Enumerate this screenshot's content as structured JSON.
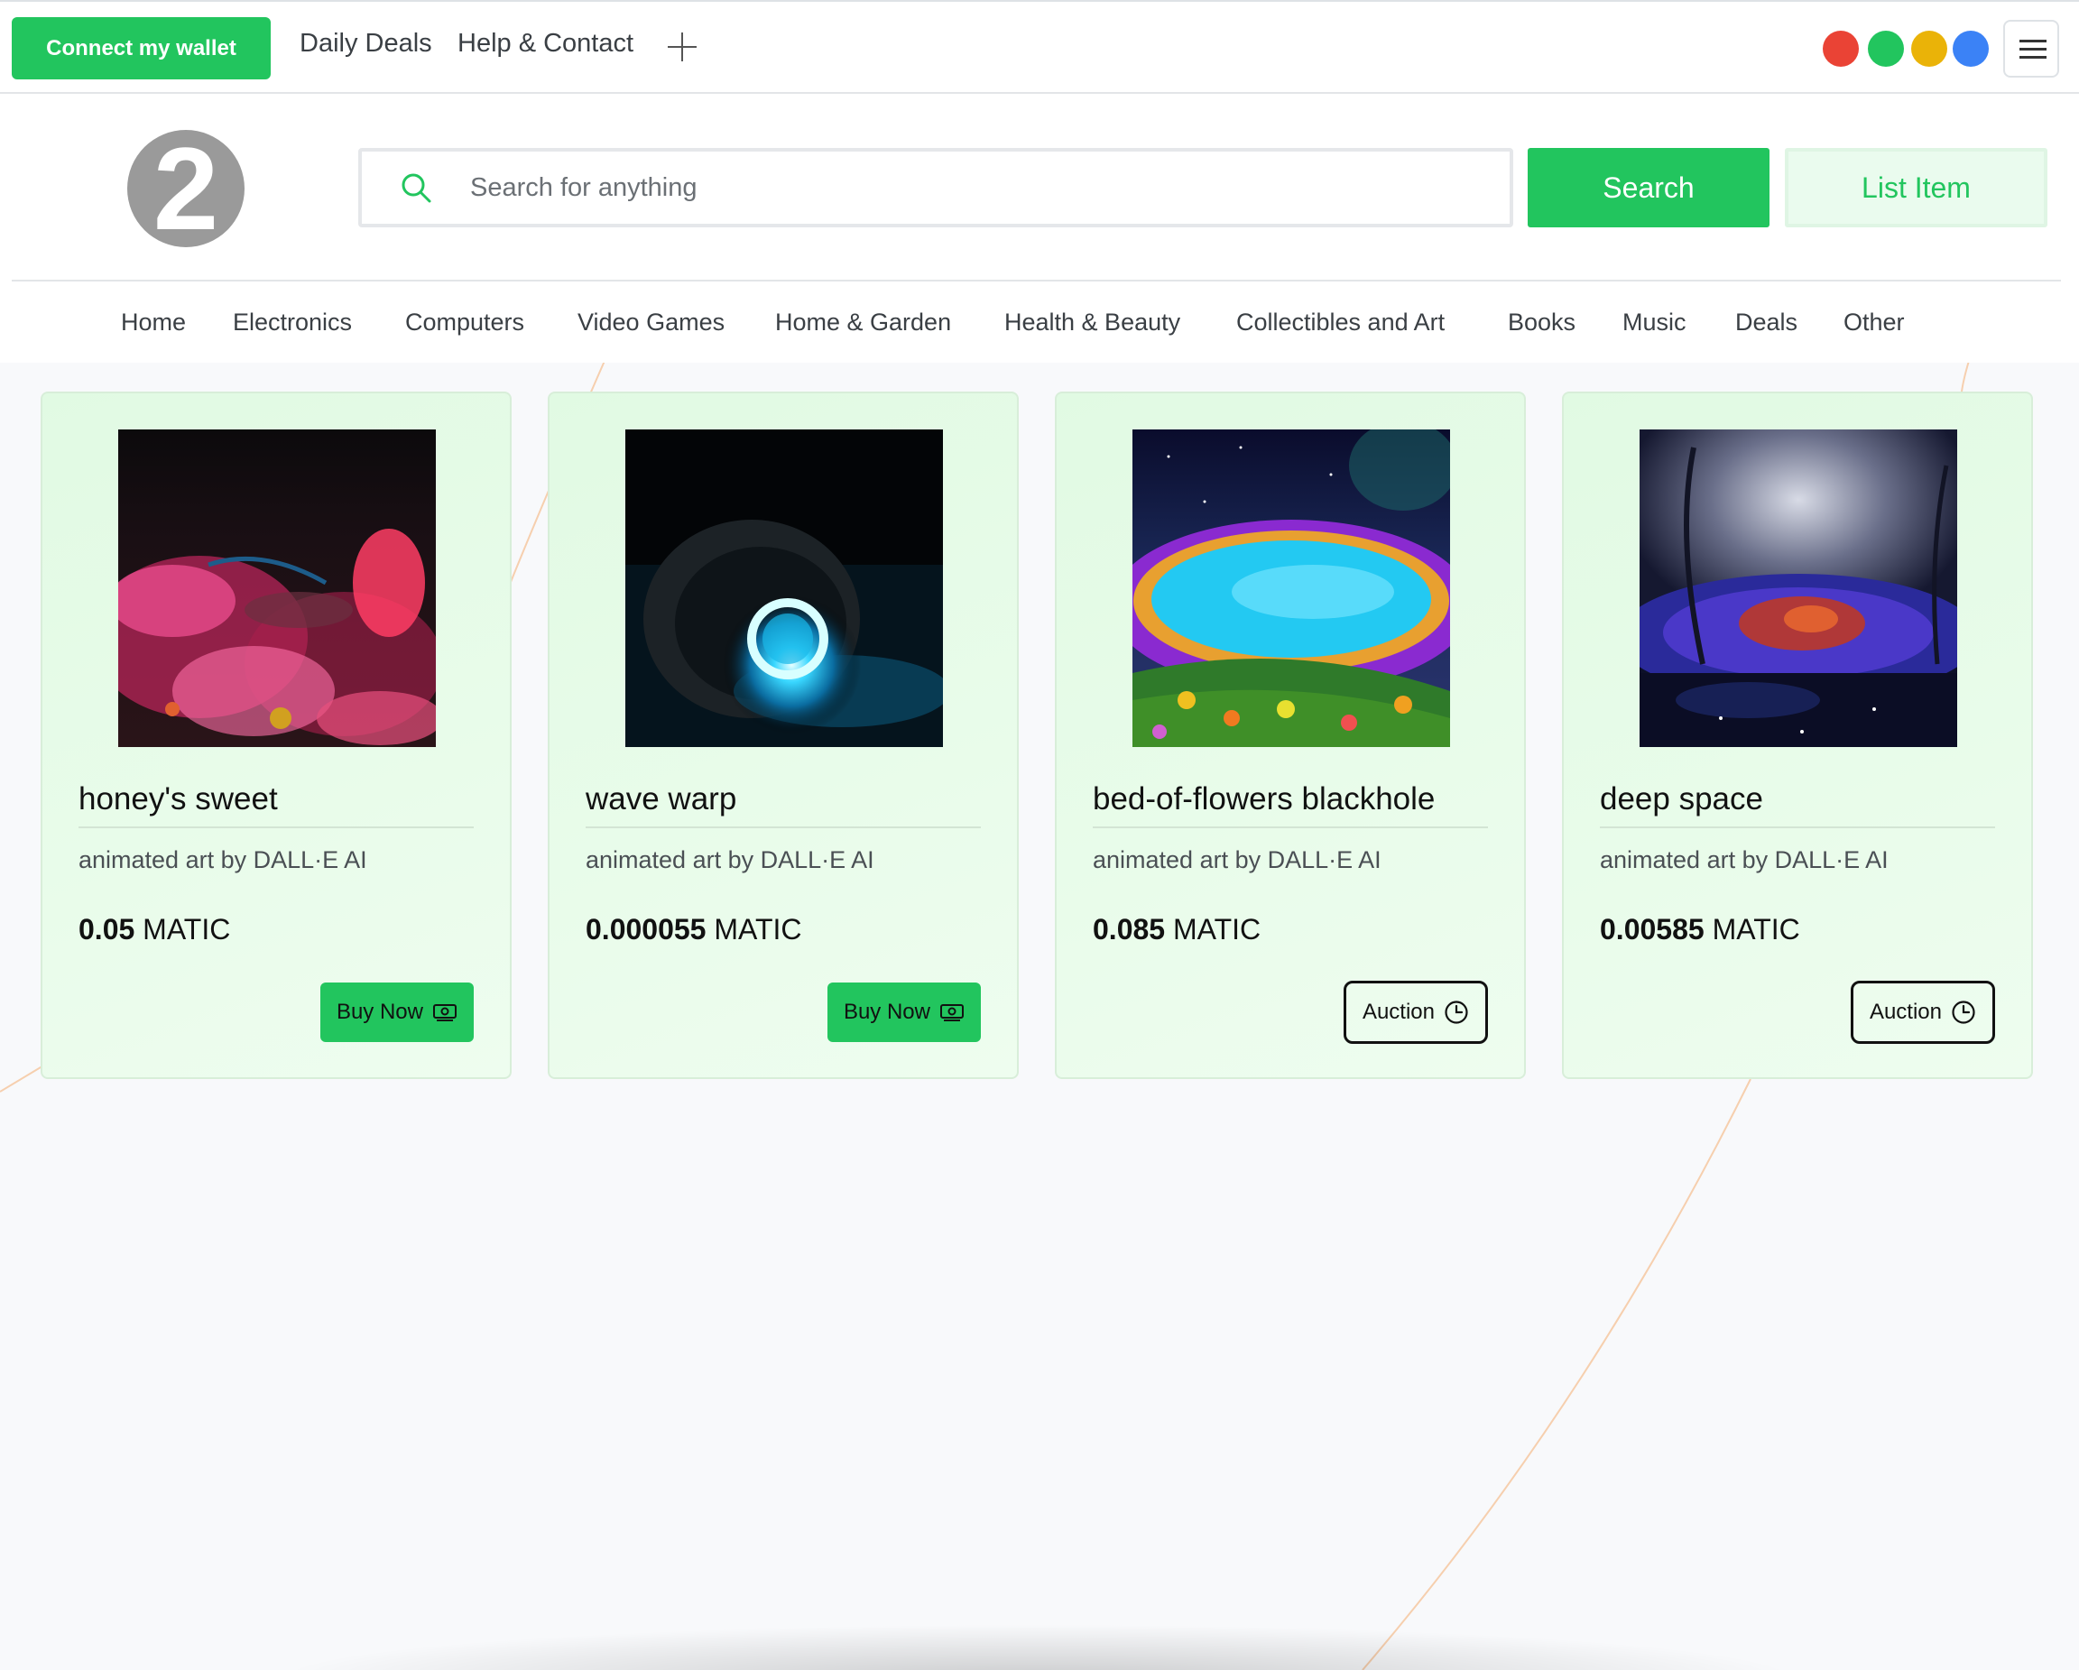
{
  "topbar": {
    "connect_label": "Connect my wallet",
    "links": [
      "Daily Deals",
      "Help & Contact"
    ],
    "dot_colors": [
      "#ea4335",
      "#22c55e",
      "#eab308",
      "#3b82f6"
    ]
  },
  "header": {
    "logo_text": "2",
    "search_placeholder": "Search for anything",
    "search_label": "Search",
    "list_label": "List Item"
  },
  "categories": [
    "Home",
    "Electronics",
    "Computers",
    "Video Games",
    "Home & Garden",
    "Health & Beauty",
    "Collectibles and Art",
    "Books",
    "Music",
    "Deals",
    "Other"
  ],
  "cards": [
    {
      "title": "honey's sweet",
      "desc": "animated art by DALL·E AI",
      "price": "0.05",
      "currency": "MATIC",
      "action": "Buy Now",
      "action_icon": "cash-icon"
    },
    {
      "title": "wave warp",
      "desc": "animated art by DALL·E AI",
      "price": "0.000055",
      "currency": "MATIC",
      "action": "Buy Now",
      "action_icon": "cash-icon"
    },
    {
      "title": "bed-of-flowers blackhole",
      "desc": "animated art by DALL·E AI",
      "price": "0.085",
      "currency": "MATIC",
      "action": "Auction",
      "action_icon": "clock-icon"
    },
    {
      "title": "deep space",
      "desc": "animated art by DALL·E AI",
      "price": "0.00585",
      "currency": "MATIC",
      "action": "Auction",
      "action_icon": "clock-icon"
    }
  ],
  "colors": {
    "accent": "#22c55e",
    "card_bg": "#e4fbe6"
  }
}
